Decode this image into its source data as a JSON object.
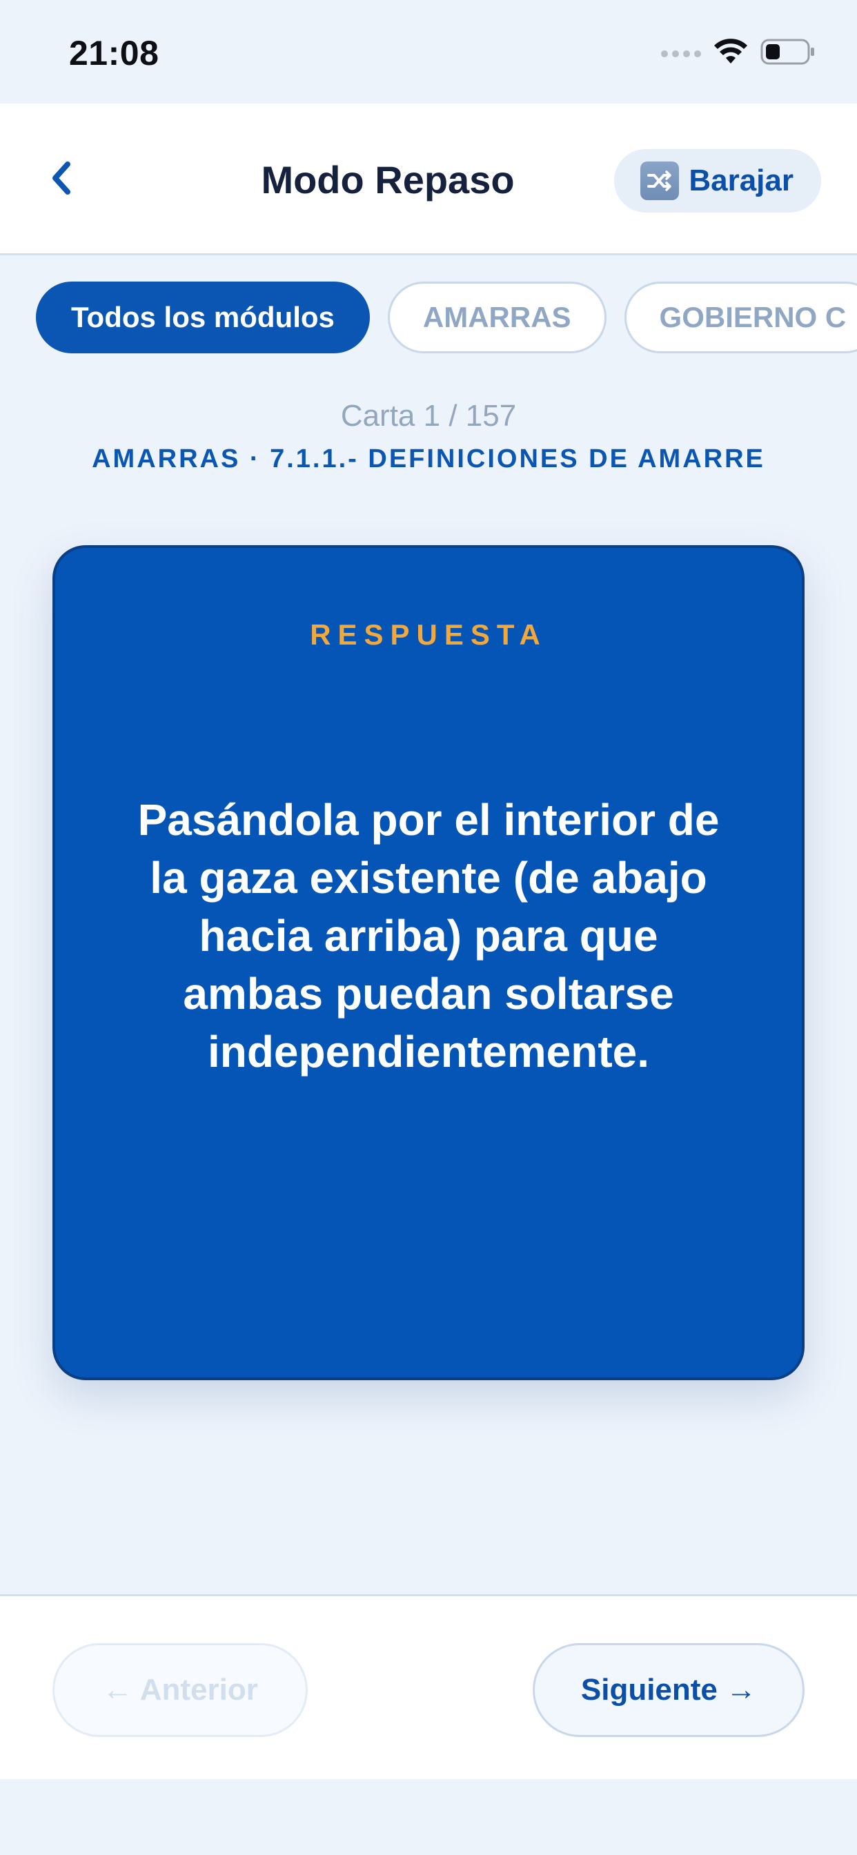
{
  "status_bar": {
    "time": "21:08",
    "icons": [
      "cellular-signal-icon",
      "wifi-icon",
      "battery-icon"
    ]
  },
  "header": {
    "back_icon": "chevron-left-icon",
    "title": "Modo Repaso",
    "shuffle": {
      "icon": "shuffle-icon",
      "label": "Barajar"
    }
  },
  "filters": {
    "chips": [
      {
        "label": "Todos los módulos",
        "active": true
      },
      {
        "label": "AMARRAS",
        "active": false
      },
      {
        "label": "GOBIERNO C",
        "active": false
      }
    ]
  },
  "card_info": {
    "counter": "Carta 1 / 157",
    "module": "AMARRAS · 7.1.1.- DEFINICIONES DE AMARRE"
  },
  "card": {
    "side_label": "RESPUESTA",
    "text": "Pasándola por el interior de la gaza existente (de abajo hacia arriba) para que ambas puedan soltarse independientemente."
  },
  "navigation": {
    "previous_label": "← Anterior",
    "previous_enabled": false,
    "next_label": "Siguiente →",
    "next_enabled": true
  },
  "colors": {
    "background": "#EDF3FB",
    "primary": "#0B55B3",
    "card": "#0455B5",
    "accent": "#F2A83B",
    "title": "#16223D"
  }
}
